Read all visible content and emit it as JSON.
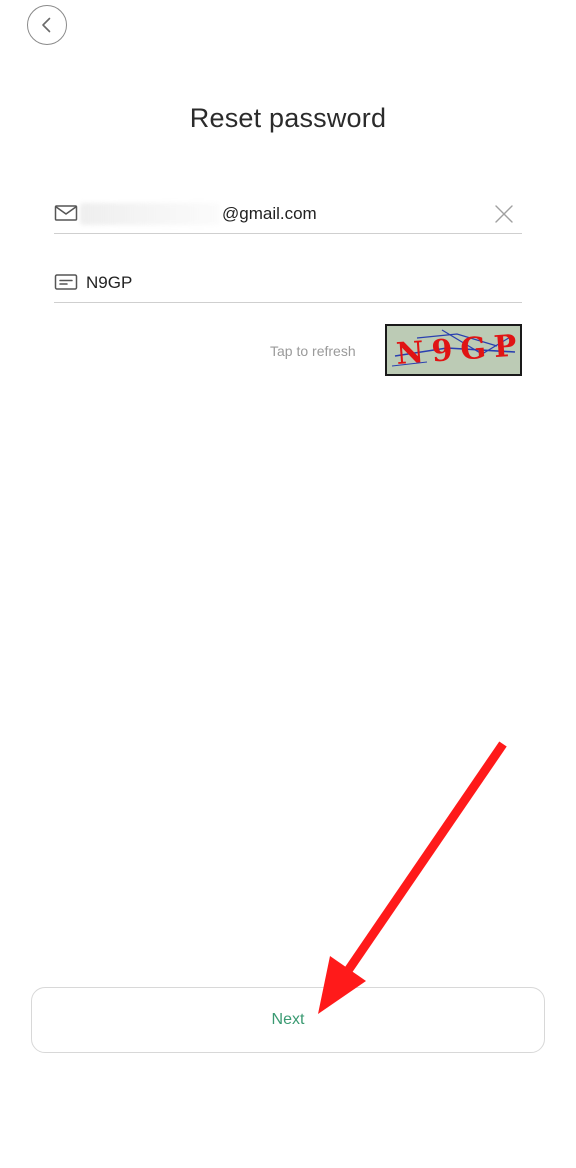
{
  "header": {
    "back_icon": "chevron-left-icon",
    "title": "Reset password"
  },
  "email_field": {
    "icon": "mail-icon",
    "value_suffix": "@gmail.com",
    "clear_icon": "close-icon"
  },
  "captcha_field": {
    "icon": "text-box-icon",
    "value": "N9GP"
  },
  "captcha": {
    "hint": "Tap to refresh",
    "image_text": "N9GP"
  },
  "footer": {
    "next_label": "Next"
  },
  "colors": {
    "accent": "#3a9a72",
    "annotation_arrow": "#ff1a1a",
    "captcha_text": "#e01414",
    "captcha_noise": "#2a3fb0"
  }
}
